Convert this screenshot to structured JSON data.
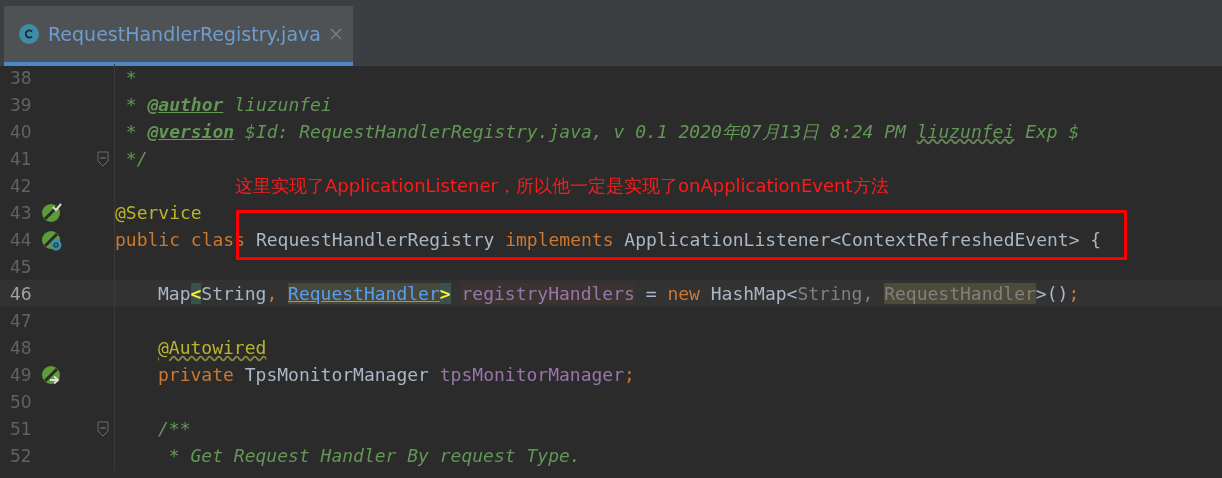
{
  "tabs": [
    {
      "label": "RequestHandlerRegistry.java",
      "selected": true
    }
  ],
  "lines": [
    {
      "number": "38",
      "current": false,
      "fold": false,
      "indent": false,
      "tokens": [
        {
          "kind": "comment",
          "text": " *"
        }
      ]
    },
    {
      "number": "39",
      "current": false,
      "fold": false,
      "indent": false,
      "tokens": [
        {
          "kind": "comment",
          "text": " * "
        },
        {
          "kind": "doctag",
          "text": "@author"
        },
        {
          "kind": "comment",
          "text": " liuzunfei"
        }
      ]
    },
    {
      "number": "40",
      "current": false,
      "fold": false,
      "indent": false,
      "tokens": [
        {
          "kind": "comment",
          "text": " * "
        },
        {
          "kind": "doctag",
          "text": "@version"
        },
        {
          "kind": "comment",
          "text": " $Id: RequestHandlerRegistry.java, v 0.1 2020年07月13日 8:24 PM "
        },
        {
          "kind": "typo-comment",
          "text": "liuzunfei"
        },
        {
          "kind": "comment",
          "text": " Exp $"
        }
      ]
    },
    {
      "number": "41",
      "current": false,
      "fold": true,
      "indent": false,
      "tokens": [
        {
          "kind": "comment",
          "text": " */"
        }
      ]
    },
    {
      "number": "42",
      "current": false,
      "fold": false
    },
    {
      "number": "43",
      "current": false,
      "fold": false,
      "indent": false,
      "gutter_icon": {
        "kind": "bean-check"
      },
      "tokens": [
        {
          "kind": "annotation",
          "text": "@Service"
        }
      ]
    },
    {
      "number": "44",
      "current": false,
      "fold": false,
      "indent": false,
      "gutter_icon": {
        "kind": "bean-class"
      },
      "tokens": [
        {
          "kind": "keyword",
          "text": "public class "
        },
        {
          "kind": "plain",
          "text": "RequestHandlerRegistry "
        },
        {
          "kind": "keyword",
          "text": "implements "
        },
        {
          "kind": "plain",
          "text": "ApplicationListener<ContextRefreshedEvent> {"
        }
      ]
    },
    {
      "number": "45",
      "current": false,
      "fold": false
    },
    {
      "number": "46",
      "current": true,
      "fold": false,
      "indent": true,
      "tokens": [
        {
          "kind": "plain",
          "text": "Map"
        },
        {
          "kind": "brace",
          "text": "<"
        },
        {
          "kind": "plain",
          "text": "String"
        },
        {
          "kind": "keyword",
          "text": ", "
        },
        {
          "kind": "link",
          "text": "RequestHandler"
        },
        {
          "kind": "brace",
          "text": ">"
        },
        {
          "kind": "field-hl",
          "text": "registryHandlers",
          "space_before": true
        },
        {
          "kind": "plain",
          "text": " = "
        },
        {
          "kind": "keyword",
          "text": "new "
        },
        {
          "kind": "plain",
          "text": "HashMap<"
        },
        {
          "kind": "muted",
          "text": "String, "
        },
        {
          "kind": "muted-hl",
          "text": "RequestHandler"
        },
        {
          "kind": "plain",
          "text": ">()"
        },
        {
          "kind": "keyword",
          "text": ";"
        }
      ]
    },
    {
      "number": "47",
      "current": false,
      "fold": false
    },
    {
      "number": "48",
      "current": false,
      "fold": false,
      "indent": true,
      "tokens": [
        {
          "kind": "typo-annotation",
          "text": "@Autowired"
        }
      ]
    },
    {
      "number": "49",
      "current": false,
      "fold": false,
      "indent": true,
      "gutter_icon": {
        "kind": "bean-inject"
      },
      "tokens": [
        {
          "kind": "keyword",
          "text": "private "
        },
        {
          "kind": "plain",
          "text": "TpsMonitorManager "
        },
        {
          "kind": "field",
          "text": "tpsMonitorManager"
        },
        {
          "kind": "keyword",
          "text": ";"
        }
      ]
    },
    {
      "number": "50",
      "current": false,
      "fold": false
    },
    {
      "number": "51",
      "current": false,
      "fold": true,
      "indent": true,
      "tokens": [
        {
          "kind": "comment",
          "text": "/**"
        }
      ]
    },
    {
      "number": "52",
      "current": false,
      "fold": false,
      "indent": true,
      "tokens": [
        {
          "kind": "comment",
          "text": " * Get Request Handler By request Type."
        }
      ]
    }
  ],
  "note": "这里实现了ApplicationListener，所以他一定是实现了onApplicationEvent方法"
}
